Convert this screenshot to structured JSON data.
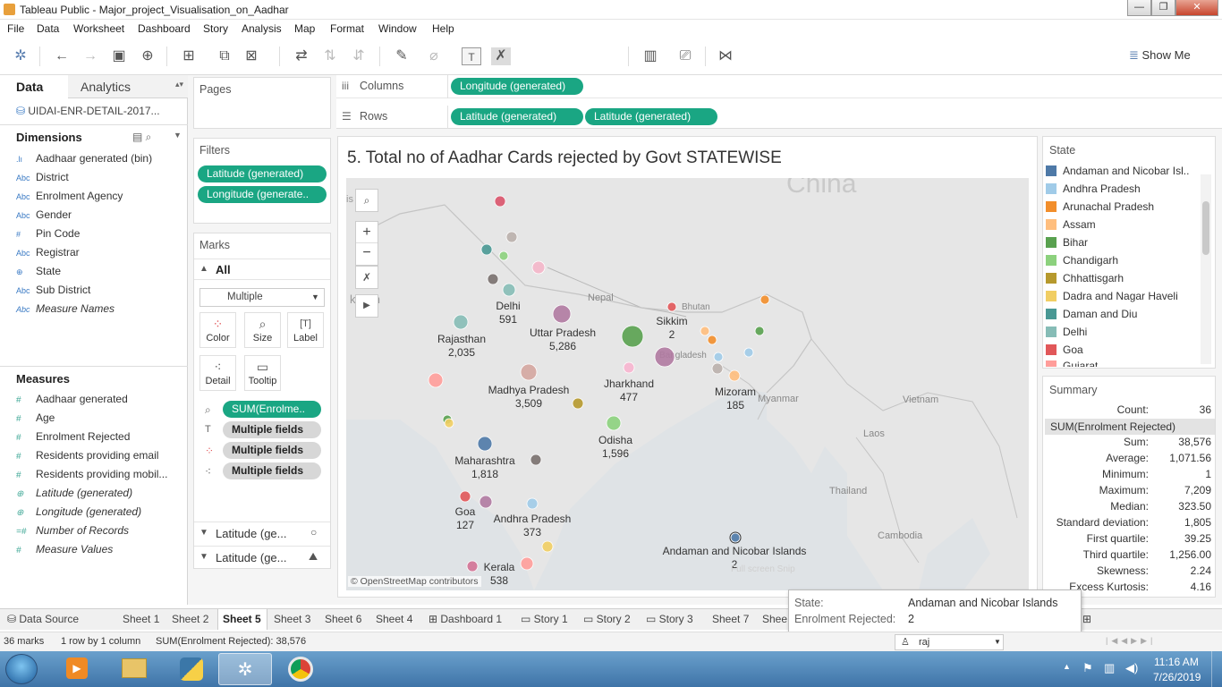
{
  "window": {
    "title": "Tableau Public - Major_project_Visualisation_on_Aadhar",
    "controls": [
      "—",
      "❐",
      "✕"
    ]
  },
  "menu": [
    "File",
    "Data",
    "Worksheet",
    "Dashboard",
    "Story",
    "Analysis",
    "Map",
    "Format",
    "Window",
    "Help"
  ],
  "toolbar": {
    "show_me": "Show Me"
  },
  "left_pane": {
    "tabs": [
      "Data",
      "Analytics"
    ],
    "datasource": "UIDAI-ENR-DETAIL-2017...",
    "dimensions_header": "Dimensions",
    "dimensions": [
      {
        "icon": ".lı",
        "label": "Aadhaar generated (bin)"
      },
      {
        "icon": "Abc",
        "label": "District"
      },
      {
        "icon": "Abc",
        "label": "Enrolment Agency"
      },
      {
        "icon": "Abc",
        "label": "Gender"
      },
      {
        "icon": "#",
        "label": "Pin Code"
      },
      {
        "icon": "Abc",
        "label": "Registrar"
      },
      {
        "icon": "⊕",
        "label": "State"
      },
      {
        "icon": "Abc",
        "label": "Sub District"
      },
      {
        "icon": "Abc",
        "label": "Measure Names"
      }
    ],
    "measures_header": "Measures",
    "measures": [
      {
        "icon": "#",
        "label": "Aadhaar generated"
      },
      {
        "icon": "#",
        "label": "Age"
      },
      {
        "icon": "#",
        "label": "Enrolment Rejected"
      },
      {
        "icon": "#",
        "label": "Residents providing email"
      },
      {
        "icon": "#",
        "label": "Residents providing mobil..."
      },
      {
        "icon": "⊕",
        "label": "Latitude (generated)"
      },
      {
        "icon": "⊕",
        "label": "Longitude (generated)"
      },
      {
        "icon": "=#",
        "label": "Number of Records"
      },
      {
        "icon": "#",
        "label": "Measure Values"
      }
    ]
  },
  "shelves": {
    "pages": "Pages",
    "filters": "Filters",
    "filter_pills": [
      "Latitude (generated)",
      "Longitude (generate.."
    ],
    "marks": "Marks",
    "marks_all": "All",
    "mark_type": "Multiple",
    "mark_buttons": [
      "Color",
      "Size",
      "Label",
      "Detail",
      "Tooltip"
    ],
    "mark_pills": [
      "SUM(Enrolme..",
      "Multiple fields",
      "Multiple fields",
      "Multiple fields"
    ],
    "mark_layers": [
      "Latitude (ge...",
      "Latitude (ge..."
    ],
    "columns_label": "Columns",
    "columns_pills": [
      "Longitude (generated)"
    ],
    "rows_label": "Rows",
    "rows_pills": [
      "Latitude (generated)",
      "Latitude (generated)"
    ]
  },
  "view": {
    "title": "5. Total no of Aadhar Cards  rejected by Govt STATEWISE",
    "attribution": "© OpenStreetMap contributors",
    "fullscreen": "Full screen Snip",
    "countries": [
      "China",
      "Nepal",
      "Bhutan",
      "Bangladesh",
      "Myanmar",
      "Vietnam",
      "Laos",
      "Thailand",
      "Cambodia",
      "kistan",
      "is"
    ],
    "state_labels": [
      {
        "name": "Delhi",
        "value": "591"
      },
      {
        "name": "Rajasthan",
        "value": "2,035"
      },
      {
        "name": "Uttar Pradesh",
        "value": "5,286"
      },
      {
        "name": "Sikkim",
        "value": "2"
      },
      {
        "name": "Madhya Pradesh",
        "value": "3,509"
      },
      {
        "name": "Jharkhand",
        "value": "477"
      },
      {
        "name": "Mizoram",
        "value": "185"
      },
      {
        "name": "Odisha",
        "value": "1,596"
      },
      {
        "name": "Maharashtra",
        "value": "1,818"
      },
      {
        "name": "Goa",
        "value": "127"
      },
      {
        "name": "Andhra Pradesh",
        "value": "373"
      },
      {
        "name": "Andaman and Nicobar Islands",
        "value": "2"
      },
      {
        "name": "Kerala",
        "value": "538"
      }
    ]
  },
  "legend": {
    "title": "State",
    "items": [
      {
        "label": "Andaman and Nicobar Isl..",
        "color": "#4e79a7"
      },
      {
        "label": "Andhra Pradesh",
        "color": "#a0cbe8"
      },
      {
        "label": "Arunachal Pradesh",
        "color": "#f28e2b"
      },
      {
        "label": "Assam",
        "color": "#ffbe7d"
      },
      {
        "label": "Bihar",
        "color": "#59a14f"
      },
      {
        "label": "Chandigarh",
        "color": "#8cd17d"
      },
      {
        "label": "Chhattisgarh",
        "color": "#b6992d"
      },
      {
        "label": "Dadra and Nagar Haveli",
        "color": "#f1ce63"
      },
      {
        "label": "Daman and Diu",
        "color": "#499894"
      },
      {
        "label": "Delhi",
        "color": "#86bcb6"
      },
      {
        "label": "Goa",
        "color": "#e15759"
      },
      {
        "label": "Gujarat",
        "color": "#ff9d9a"
      }
    ]
  },
  "summary": {
    "title": "Summary",
    "measure": "SUM(Enrolment Rejected)",
    "count_label": "Count:",
    "count": "36",
    "rows": [
      {
        "k": "Sum:",
        "v": "38,576"
      },
      {
        "k": "Average:",
        "v": "1,071.56"
      },
      {
        "k": "Minimum:",
        "v": "1"
      },
      {
        "k": "Maximum:",
        "v": "7,209"
      },
      {
        "k": "Median:",
        "v": "323.50"
      },
      {
        "k": "Standard deviation:",
        "v": "1,805"
      },
      {
        "k": "First quartile:",
        "v": "39.25"
      },
      {
        "k": "Third quartile:",
        "v": "1,256.00"
      },
      {
        "k": "Skewness:",
        "v": "2.24"
      },
      {
        "k": "Excess Kurtosis:",
        "v": "4.16"
      }
    ]
  },
  "tooltip": {
    "state_label": "State:",
    "state_value": "Andaman and Nicobar Islands",
    "rej_label": "Enrolment Rejected:",
    "rej_value": "2"
  },
  "sheet_tabs": [
    "Data Source",
    "Sheet 1",
    "Sheet 2",
    "Sheet 5",
    "Sheet 3",
    "Sheet 6",
    "Sheet 4",
    "Dashboard 1",
    "Story 1",
    "Story 2",
    "Story 3",
    "Sheet 7",
    "Shee"
  ],
  "active_tab": "Sheet 5",
  "status": {
    "marks": "36 marks",
    "dims": "1 row by 1 column",
    "sum": "SUM(Enrolment Rejected): 38,576",
    "user": "raj"
  },
  "clock": {
    "time": "11:16 AM",
    "date": "7/26/2019"
  }
}
